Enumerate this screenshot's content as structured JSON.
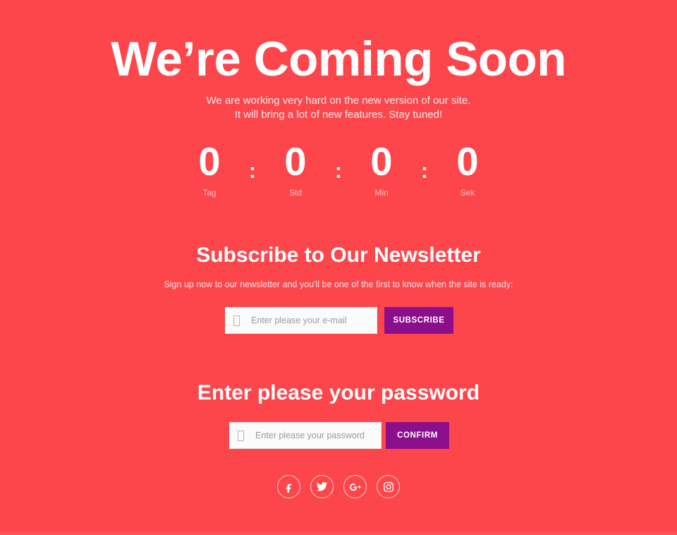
{
  "theme": {
    "background": "#fc464c",
    "text": "#ffffff",
    "button": "#8b0f8b",
    "muted": "#f8c3c4",
    "field_background": "#fbfbfb"
  },
  "hero": {
    "title": "We’re Coming Soon",
    "line1": "We are working very hard on the new version of our site.",
    "line2": "It will bring a lot of new features. Stay tuned!"
  },
  "countdown": {
    "separator": ":",
    "units": [
      {
        "value": "0",
        "label": "Tag"
      },
      {
        "value": "0",
        "label": "Std"
      },
      {
        "value": "0",
        "label": "Min"
      },
      {
        "value": "0",
        "label": "Sek"
      }
    ]
  },
  "newsletter": {
    "title": "Subscribe to Our Newsletter",
    "subtitle": "Sign up now to our newsletter and you'll be one of the first to know when the site is ready:",
    "input": {
      "value": "",
      "placeholder": "Enter please your e-mail",
      "icon": "envelope-icon-missing-glyph"
    },
    "button_label": "SUBSCRIBE"
  },
  "password": {
    "title": "Enter please your password",
    "input": {
      "value": "",
      "placeholder": "Enter please your password",
      "icon": "lock-icon-missing-glyph"
    },
    "button_label": "CONFIRM"
  },
  "social": {
    "items": [
      {
        "name": "facebook",
        "label": "Facebook"
      },
      {
        "name": "twitter",
        "label": "Twitter"
      },
      {
        "name": "google-plus",
        "label": "Google Plus"
      },
      {
        "name": "instagram",
        "label": "Instagram"
      }
    ]
  }
}
